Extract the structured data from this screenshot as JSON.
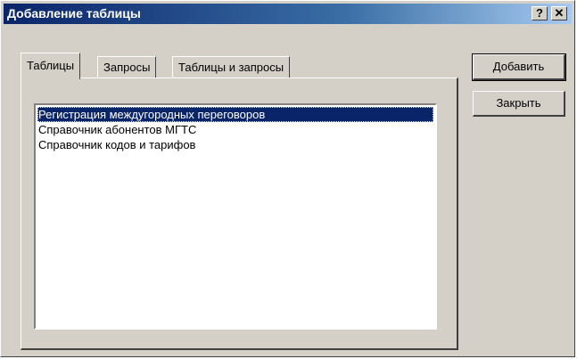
{
  "window": {
    "title": "Добавление таблицы",
    "help_label": "?",
    "close_label": "✕"
  },
  "tabs": [
    {
      "label": "Таблицы",
      "active": true
    },
    {
      "label": "Запросы",
      "active": false
    },
    {
      "label": "Таблицы и запросы",
      "active": false
    }
  ],
  "list": {
    "items": [
      {
        "label": "Регистрация междугородных переговоров",
        "selected": true
      },
      {
        "label": "Справочник абонентов МГТС",
        "selected": false
      },
      {
        "label": "Справочник кодов и тарифов",
        "selected": false
      }
    ]
  },
  "buttons": {
    "add_label": "Добавить",
    "close_label": "Закрыть"
  },
  "colors": {
    "selection": "#0a246a",
    "titlebar_start": "#0a246a",
    "titlebar_end": "#a6caf0",
    "face": "#d4d0c8"
  }
}
